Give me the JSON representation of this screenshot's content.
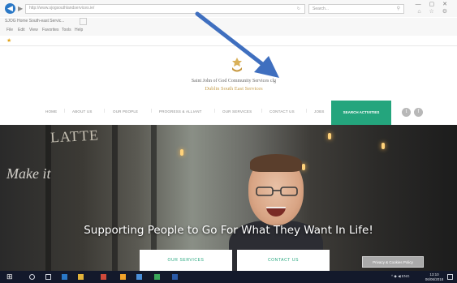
{
  "browser": {
    "address_url": "http://www.sjogsouthlandservices.ie/",
    "search_placeholder": "Search...",
    "tab_title": "SJOG Home South-east Servic...",
    "menu": [
      "File",
      "Edit",
      "View",
      "Favorites",
      "Tools",
      "Help"
    ],
    "window_controls": "— ▢ ✕",
    "toolbar_icons": "⌂ ☆ ⚙"
  },
  "site": {
    "org_name": "Saint John of God Community Services clg",
    "org_subtitle": "Dublin South East Services",
    "nav": [
      "HOME",
      "ABOUT US",
      "OUR PEOPLE",
      "PROGRESS & ALLIANT",
      "OUR SERVICES",
      "CONTACT US",
      "JOBS"
    ],
    "nav_cta": "SEARCH ACTIVITIES",
    "social": [
      "twitter-icon",
      "facebook-icon"
    ]
  },
  "hero": {
    "bg_sign_1": "LATTE",
    "bg_sign_2": "Make it",
    "heading": "Supporting People to Go For What They Want In Life!",
    "btn_services": "OUR SERVICES",
    "btn_contact": "CONTACT US",
    "privacy_label": "Privacy & Cookies Policy"
  },
  "taskbar": {
    "tray": "^ ◆ ◀ ENG",
    "time": "13:10",
    "date": "06/06/2018"
  },
  "colors": {
    "accent_green": "#24a57d",
    "gold": "#c6a04f",
    "annotation_arrow": "#3f6fbf",
    "taskbar": "#13192b"
  }
}
